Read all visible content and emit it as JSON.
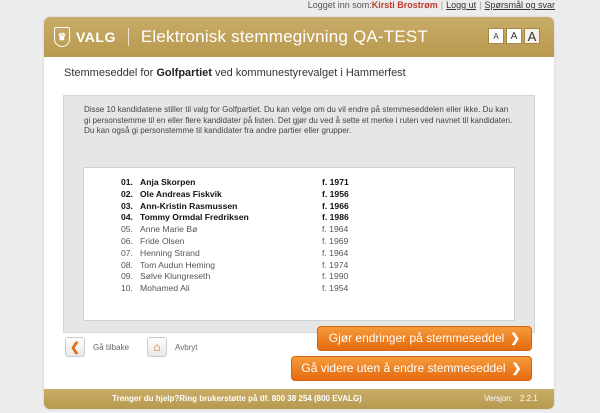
{
  "topbar": {
    "logged_in_label": "Logget inn som:",
    "user_name": "Kirsti Brostrøm",
    "logout": "Logg ut",
    "help": "Spørsmål og svar"
  },
  "header": {
    "logo_text": "VALG",
    "title": "Elektronisk stemmegivning QA-TEST",
    "font_sizes": [
      "A",
      "A",
      "A"
    ]
  },
  "ballot": {
    "prefix": "Stemmeseddel for ",
    "party": "Golfpartiet",
    "suffix": " ved kommunestyrevalget i Hammerfest"
  },
  "intro_text": "Disse 10 kandidatene stiller til valg for Golfpartiet. Du kan velge om du vil endre på stemmeseddelen eller ikke. Du kan gi personstemme til en eller flere kandidater på listen. Det gjør du ved å sette et merke i ruten ved navnet til kandidaten. Du kan også gi personstemme til kandidater fra andre partier eller grupper.",
  "candidates": [
    {
      "num": "01.",
      "name": "Anja Skorpen",
      "year": "f. 1971",
      "bold": true
    },
    {
      "num": "02.",
      "name": "Ole Andreas Fiskvik",
      "year": "f. 1956",
      "bold": true
    },
    {
      "num": "03.",
      "name": "Ann-Kristin Rasmussen",
      "year": "f. 1966",
      "bold": true
    },
    {
      "num": "04.",
      "name": "Tommy Ormdal Fredriksen",
      "year": "f. 1986",
      "bold": true
    },
    {
      "num": "05.",
      "name": "Anne Marie Bø",
      "year": "f. 1964",
      "bold": false
    },
    {
      "num": "06.",
      "name": "Fride Olsen",
      "year": "f. 1969",
      "bold": false
    },
    {
      "num": "07.",
      "name": "Henning Strand",
      "year": "f. 1964",
      "bold": false
    },
    {
      "num": "08.",
      "name": "Tom Audun Heming",
      "year": "f. 1974",
      "bold": false
    },
    {
      "num": "09.",
      "name": "Sølve Klungreseth",
      "year": "f. 1990",
      "bold": false
    },
    {
      "num": "10.",
      "name": "Mohamed Ali",
      "year": "f. 1954",
      "bold": false
    }
  ],
  "buttons": {
    "change": "Gjør endringer på stemmeseddel",
    "continue": "Gå videre uten å endre stemmeseddel",
    "back": "Gå tilbake",
    "cancel": "Avbryt"
  },
  "footer": {
    "help_text": "Trenger du hjelp?Ring brukerstøtte på tlf. 800 38 254 (800 EVALG)",
    "version_label": "Versjon:",
    "version_number": "2.2.1"
  },
  "colors": {
    "header_gold": "#c0a35c",
    "accent_orange": "#e56a0f",
    "user_red": "#c0392b"
  }
}
